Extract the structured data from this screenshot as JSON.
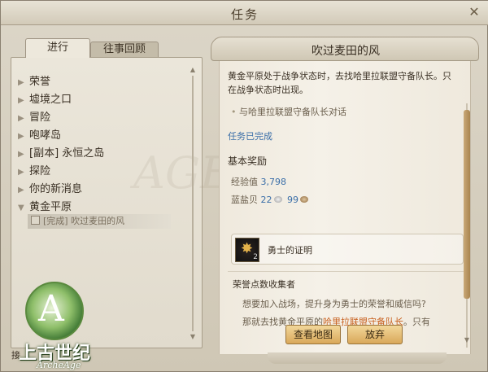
{
  "window": {
    "title": "任务",
    "close_glyph": "✕"
  },
  "tabs": [
    {
      "label": "进行",
      "active": true
    },
    {
      "label": "往事回顾",
      "active": false
    }
  ],
  "categories": [
    {
      "label": "荣誉",
      "expanded": false
    },
    {
      "label": "墟境之口",
      "expanded": false
    },
    {
      "label": "冒险",
      "expanded": false
    },
    {
      "label": "咆哮岛",
      "expanded": false
    },
    {
      "label": "[副本] 永恒之岛",
      "expanded": false
    },
    {
      "label": "探险",
      "expanded": false
    },
    {
      "label": "你的新消息",
      "expanded": false
    },
    {
      "label": "黄金平原",
      "expanded": true
    }
  ],
  "selected_quest": {
    "label": "[完成] 吹过麦田的风"
  },
  "watermark": "AGE",
  "logo": {
    "cn": "上古世纪",
    "en": "ArcheAge"
  },
  "bottom_label": "接",
  "quest": {
    "title": "吹过麦田的风",
    "description": "黄金平原处于战争状态时，去找哈里拉联盟守备队长。只在战争状态时出现。",
    "objective": "与哈里拉联盟守备队长对话",
    "status": "任务已完成",
    "rewards_heading": "基本奖励",
    "xp_label": "经验值",
    "xp_value": "3,798",
    "currency_label": "蓝盐贝",
    "silver": "22",
    "bronze": "99",
    "item_name": "勇士的证明",
    "item_count": "2",
    "sub_title": "荣誉点数收集者",
    "line1": "想要加入战场，提升身为勇士的荣誉和威信吗?",
    "line2_prefix": "那就去找黄金平原的",
    "line2_highlight": "哈里拉联盟守备队长",
    "line2_suffix": "。只有"
  },
  "buttons": {
    "map": "查看地图",
    "abandon": "放弃"
  }
}
